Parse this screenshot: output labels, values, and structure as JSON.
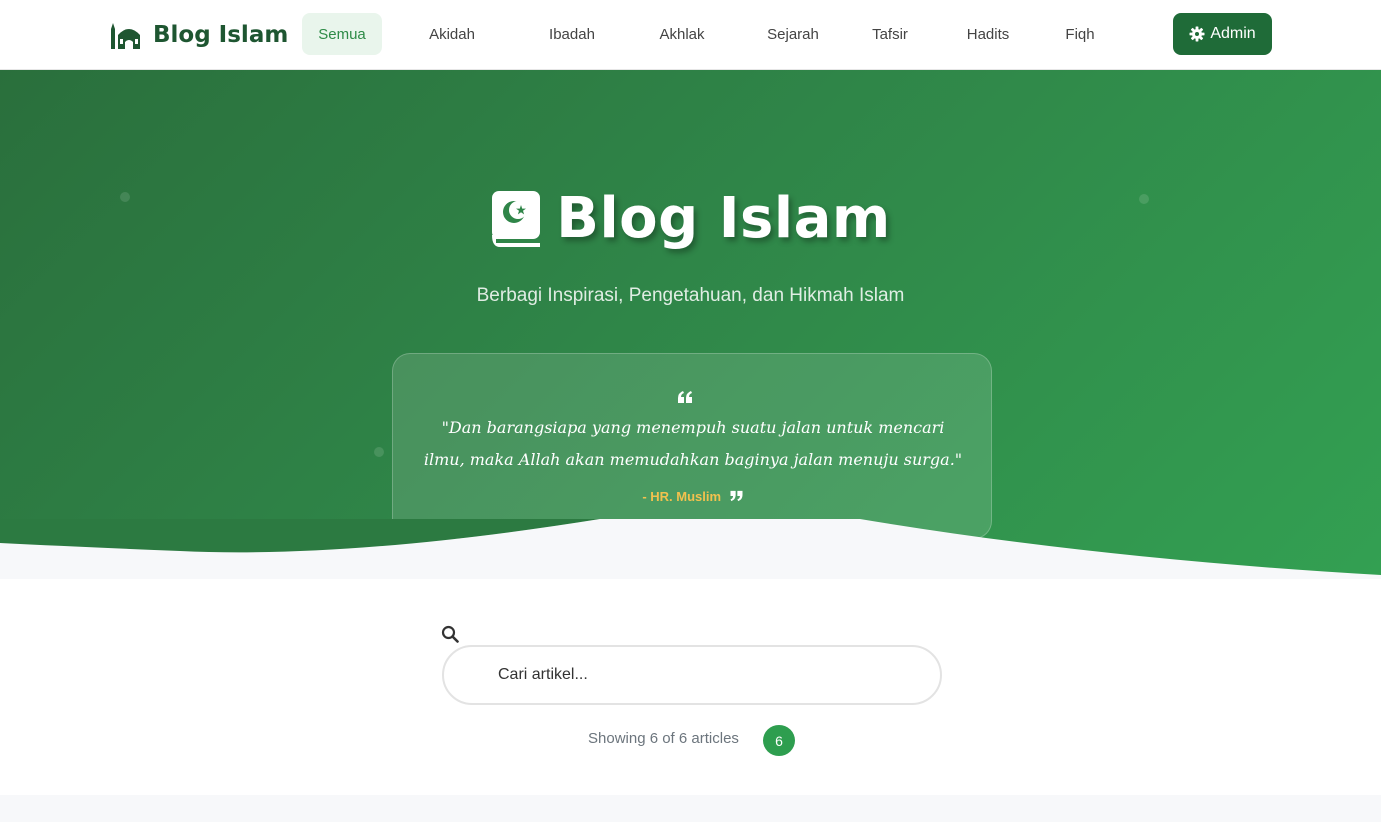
{
  "brand": {
    "name": "Blog Islam",
    "icon": "mosque-icon"
  },
  "nav": {
    "items": [
      {
        "label": "Semua",
        "active": true,
        "width": 80
      },
      {
        "label": "Akidah",
        "active": false
      },
      {
        "label": "Ibadah",
        "active": false
      },
      {
        "label": "Akhlak",
        "active": false
      },
      {
        "label": "Sejarah",
        "active": false
      },
      {
        "label": "Tafsir",
        "active": false
      },
      {
        "label": "Hadits",
        "active": false
      },
      {
        "label": "Fiqh",
        "active": false
      }
    ],
    "admin_label": "Admin",
    "admin_icon": "gear-icon"
  },
  "hero": {
    "title": "Blog Islam",
    "title_icon": "quran-icon",
    "subtitle": "Berbagi Inspirasi, Pengetahuan, dan Hikmah Islam",
    "quote": {
      "text": "\"Dan barangsiapa yang menempuh suatu jalan untuk mencari ilmu, maka Allah akan memudahkan baginya jalan menuju surga.\"",
      "source": "- HR. Muslim"
    }
  },
  "search": {
    "placeholder": "Cari artikel...",
    "value": ""
  },
  "results": {
    "text": "Showing 6 of 6 articles",
    "count": "6"
  },
  "colors": {
    "primary_dark": "#1e5631",
    "primary": "#2e9e4f",
    "accent_gold": "#f2c14e",
    "nav_active_bg": "#e9f5ec"
  }
}
